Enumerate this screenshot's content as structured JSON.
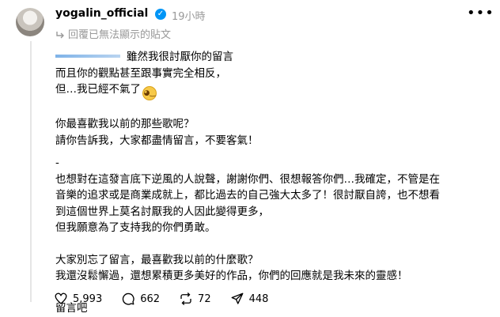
{
  "header": {
    "username": "yogalin_official",
    "verified_glyph": "✓",
    "time": "19小時",
    "more_glyph": "•••",
    "reply_context": "回覆已無法顯示的貼文"
  },
  "post": {
    "lines": [
      "雖然我很討厭你的留言",
      "而且你的觀點甚至跟事實完全相反，",
      "但…我已經不氣了",
      "你最喜歡我以前的那些歌呢？",
      "請你告訴我，大家都盡情留言，不要客氣！",
      "-",
      "也想對在這發言底下逆風的人說聲，謝謝你們、很想報答你們…我確定，不管是在",
      "音樂的追求或是商業成就上，都比過去的自己強大太多了！很討厭自誇，也不想看",
      "到這個世界上莫名討厭我的人因此變得更多，",
      "但我願意為了支持我的你們勇敢。",
      "大家別忘了留言，最喜歡我以前的什麼歌？",
      "我還沒鬆懈過，還想累積更多美好的作品，你們的回應就是我未來的靈感！",
      "留言吧"
    ]
  },
  "actions": {
    "likes": "5,993",
    "comments": "662",
    "reposts": "72",
    "shares": "448"
  },
  "colors": {
    "verified": "#0095f6",
    "muted_text": "#999999"
  }
}
